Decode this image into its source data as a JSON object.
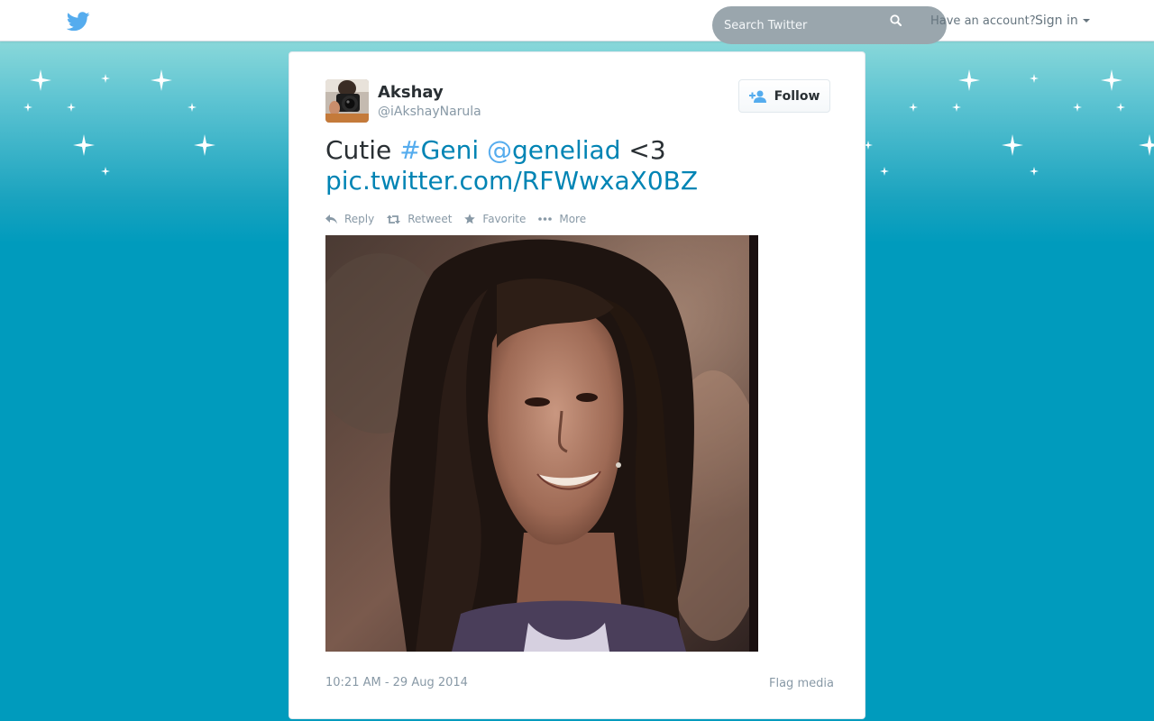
{
  "topbar": {
    "search": {
      "placeholder": "Search Twitter"
    },
    "have_account": "Have an account?",
    "signin": "Sign in"
  },
  "tweet": {
    "author": {
      "name": "Akshay",
      "handle": "@iAkshayNarula"
    },
    "follow_label": "Follow",
    "text": {
      "prefix": "Cutie ",
      "hashtag_symbol": "#",
      "hashtag": "Geni",
      "mention_symbol": "@",
      "mention": "geneliad",
      "suffix": " <3",
      "pic_link": "pic.twitter.com/RFWwxaX0BZ"
    },
    "actions": {
      "reply": "Reply",
      "retweet": "Retweet",
      "favorite": "Favorite",
      "more": "More"
    },
    "timestamp": "10:21 AM - 29 Aug 2014",
    "flag_media": "Flag media"
  },
  "colors": {
    "link": "#0084b4",
    "twitter_blue": "#55acee",
    "background_teal": "#009bbd"
  }
}
